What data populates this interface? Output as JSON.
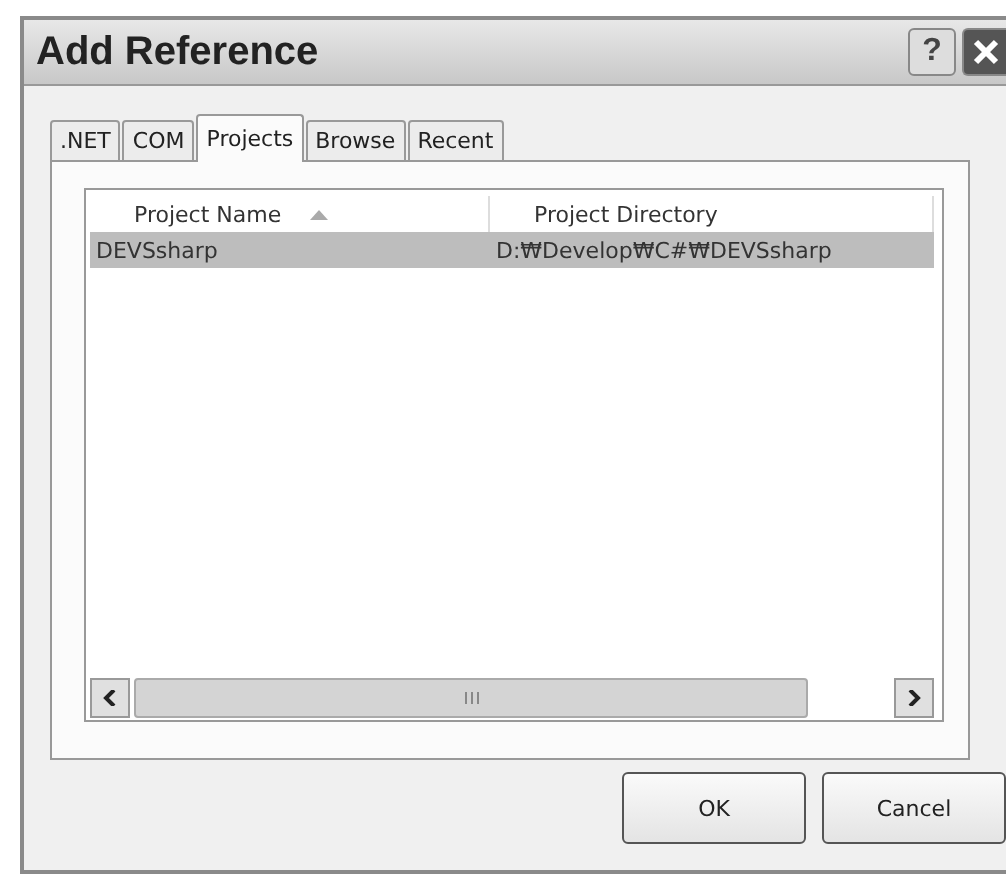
{
  "window": {
    "title": "Add Reference",
    "help_button": "?"
  },
  "tabs": [
    {
      "label": ".NET",
      "selected": false
    },
    {
      "label": "COM",
      "selected": false
    },
    {
      "label": "Projects",
      "selected": true
    },
    {
      "label": "Browse",
      "selected": false
    },
    {
      "label": "Recent",
      "selected": false
    }
  ],
  "table": {
    "columns": [
      {
        "label": "Project Name",
        "sorted": true
      },
      {
        "label": "Project Directory",
        "sorted": false
      }
    ],
    "rows": [
      {
        "cells": [
          "DEVSsharp",
          "D:₩Develop₩C#₩DEVSsharp"
        ],
        "selected": true
      }
    ]
  },
  "buttons": [
    {
      "label": "OK"
    },
    {
      "label": "Cancel"
    }
  ]
}
